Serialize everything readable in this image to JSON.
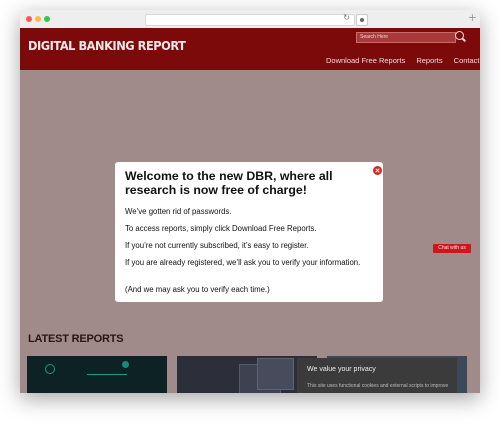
{
  "site": {
    "logo_text": "DIGITAL BANKING REPORT",
    "search_placeholder": "Search Here",
    "nav": [
      "Download Free Reports",
      "Reports",
      "Contact"
    ]
  },
  "chat_button": "Chat with us",
  "latest_reports_title": "LATEST REPORTS",
  "privacy": {
    "title": "We value your privacy",
    "text": "This site uses functional cookies and external scripts to improve your experience. Privacy Policy"
  },
  "modal": {
    "title": "Welcome to the new DBR, where all research is now free of charge!",
    "paragraphs": [
      "We’ve gotten rid of passwords.",
      "To access reports, simply click Download Free Reports.",
      "If you’re not currently subscribed, it’s easy to register.",
      "If you are already registered, we’ll ask you to verify your information.",
      "(And we may ask you to verify each time.)"
    ]
  },
  "colors": {
    "header": "#7c0a0b",
    "overlay": "#a18a8a",
    "close_button": "#d9251d",
    "privacy_bg": "#3b3b3b"
  },
  "icons": [
    "reload-icon",
    "new-tab-icon",
    "search-icon",
    "close-icon"
  ]
}
